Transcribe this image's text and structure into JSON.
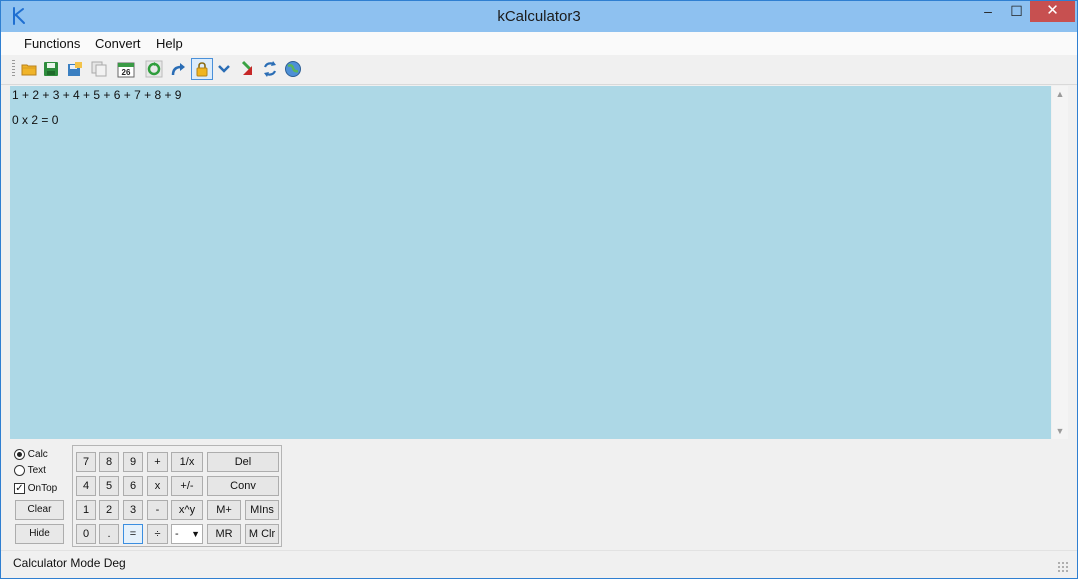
{
  "window": {
    "title": "kCalculator3",
    "controls": {
      "minimize": "–",
      "maximize": "☐",
      "close": "✕"
    }
  },
  "menu": {
    "items": [
      "Functions",
      "Convert",
      "Help"
    ]
  },
  "toolbar": {
    "icons": [
      "open-folder-icon",
      "save-icon",
      "save-as-icon",
      "copy-icon",
      "calendar-icon",
      "refresh-icon",
      "redo-icon",
      "lock-icon",
      "expand-down-icon",
      "arrow-down-icon",
      "swap-icon",
      "globe-icon"
    ],
    "calendar_day": "26",
    "active_icon": "lock-icon"
  },
  "editor": {
    "lines": [
      "1 + 2 + 3 + 4 + 5 + 6 + 7 + 8 + 9",
      "",
      "0 x 2 = 0"
    ],
    "background": "#add8e6"
  },
  "mode_panel": {
    "calc_label": "Calc",
    "text_label": "Text",
    "ontop_label": "OnTop",
    "selected_mode": "Calc",
    "ontop_checked": true,
    "clear_label": "Clear",
    "hide_label": "Hide"
  },
  "keypad": {
    "row1": [
      "7",
      "8",
      "9",
      "+",
      "1/x",
      "Del"
    ],
    "row2": [
      "4",
      "5",
      "6",
      "x",
      "+/-",
      "Conv"
    ],
    "row3": [
      "1",
      "2",
      "3",
      "-",
      "x^y",
      "M+",
      "MIns"
    ],
    "row4": [
      "0",
      ".",
      "=",
      "÷",
      "-",
      "MR",
      "M Clr"
    ]
  },
  "status": {
    "text": "Calculator Mode  Deg"
  }
}
